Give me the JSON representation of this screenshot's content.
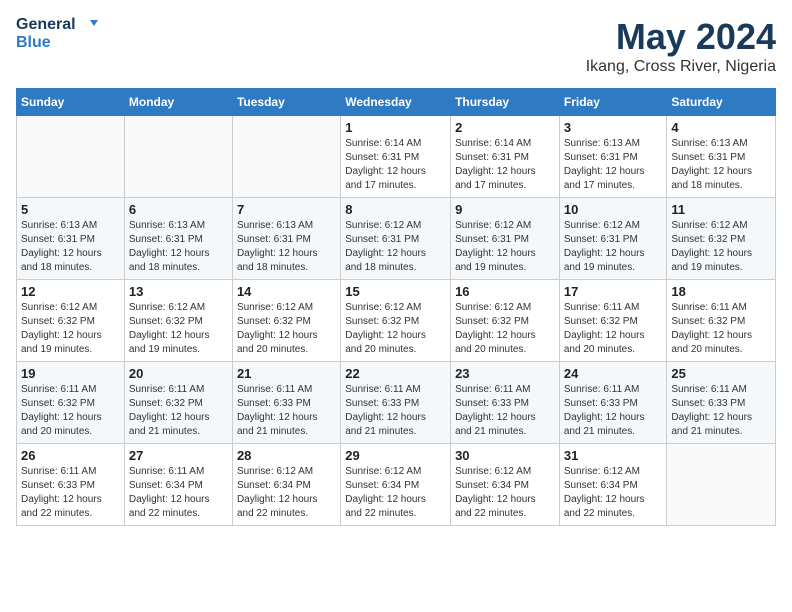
{
  "logo": {
    "line1": "General",
    "line2": "Blue"
  },
  "title": "May 2024",
  "subtitle": "Ikang, Cross River, Nigeria",
  "days_header": [
    "Sunday",
    "Monday",
    "Tuesday",
    "Wednesday",
    "Thursday",
    "Friday",
    "Saturday"
  ],
  "weeks": [
    [
      {
        "day": "",
        "info": ""
      },
      {
        "day": "",
        "info": ""
      },
      {
        "day": "",
        "info": ""
      },
      {
        "day": "1",
        "info": "Sunrise: 6:14 AM\nSunset: 6:31 PM\nDaylight: 12 hours\nand 17 minutes."
      },
      {
        "day": "2",
        "info": "Sunrise: 6:14 AM\nSunset: 6:31 PM\nDaylight: 12 hours\nand 17 minutes."
      },
      {
        "day": "3",
        "info": "Sunrise: 6:13 AM\nSunset: 6:31 PM\nDaylight: 12 hours\nand 17 minutes."
      },
      {
        "day": "4",
        "info": "Sunrise: 6:13 AM\nSunset: 6:31 PM\nDaylight: 12 hours\nand 18 minutes."
      }
    ],
    [
      {
        "day": "5",
        "info": "Sunrise: 6:13 AM\nSunset: 6:31 PM\nDaylight: 12 hours\nand 18 minutes."
      },
      {
        "day": "6",
        "info": "Sunrise: 6:13 AM\nSunset: 6:31 PM\nDaylight: 12 hours\nand 18 minutes."
      },
      {
        "day": "7",
        "info": "Sunrise: 6:13 AM\nSunset: 6:31 PM\nDaylight: 12 hours\nand 18 minutes."
      },
      {
        "day": "8",
        "info": "Sunrise: 6:12 AM\nSunset: 6:31 PM\nDaylight: 12 hours\nand 18 minutes."
      },
      {
        "day": "9",
        "info": "Sunrise: 6:12 AM\nSunset: 6:31 PM\nDaylight: 12 hours\nand 19 minutes."
      },
      {
        "day": "10",
        "info": "Sunrise: 6:12 AM\nSunset: 6:31 PM\nDaylight: 12 hours\nand 19 minutes."
      },
      {
        "day": "11",
        "info": "Sunrise: 6:12 AM\nSunset: 6:32 PM\nDaylight: 12 hours\nand 19 minutes."
      }
    ],
    [
      {
        "day": "12",
        "info": "Sunrise: 6:12 AM\nSunset: 6:32 PM\nDaylight: 12 hours\nand 19 minutes."
      },
      {
        "day": "13",
        "info": "Sunrise: 6:12 AM\nSunset: 6:32 PM\nDaylight: 12 hours\nand 19 minutes."
      },
      {
        "day": "14",
        "info": "Sunrise: 6:12 AM\nSunset: 6:32 PM\nDaylight: 12 hours\nand 20 minutes."
      },
      {
        "day": "15",
        "info": "Sunrise: 6:12 AM\nSunset: 6:32 PM\nDaylight: 12 hours\nand 20 minutes."
      },
      {
        "day": "16",
        "info": "Sunrise: 6:12 AM\nSunset: 6:32 PM\nDaylight: 12 hours\nand 20 minutes."
      },
      {
        "day": "17",
        "info": "Sunrise: 6:11 AM\nSunset: 6:32 PM\nDaylight: 12 hours\nand 20 minutes."
      },
      {
        "day": "18",
        "info": "Sunrise: 6:11 AM\nSunset: 6:32 PM\nDaylight: 12 hours\nand 20 minutes."
      }
    ],
    [
      {
        "day": "19",
        "info": "Sunrise: 6:11 AM\nSunset: 6:32 PM\nDaylight: 12 hours\nand 20 minutes."
      },
      {
        "day": "20",
        "info": "Sunrise: 6:11 AM\nSunset: 6:32 PM\nDaylight: 12 hours\nand 21 minutes."
      },
      {
        "day": "21",
        "info": "Sunrise: 6:11 AM\nSunset: 6:33 PM\nDaylight: 12 hours\nand 21 minutes."
      },
      {
        "day": "22",
        "info": "Sunrise: 6:11 AM\nSunset: 6:33 PM\nDaylight: 12 hours\nand 21 minutes."
      },
      {
        "day": "23",
        "info": "Sunrise: 6:11 AM\nSunset: 6:33 PM\nDaylight: 12 hours\nand 21 minutes."
      },
      {
        "day": "24",
        "info": "Sunrise: 6:11 AM\nSunset: 6:33 PM\nDaylight: 12 hours\nand 21 minutes."
      },
      {
        "day": "25",
        "info": "Sunrise: 6:11 AM\nSunset: 6:33 PM\nDaylight: 12 hours\nand 21 minutes."
      }
    ],
    [
      {
        "day": "26",
        "info": "Sunrise: 6:11 AM\nSunset: 6:33 PM\nDaylight: 12 hours\nand 22 minutes."
      },
      {
        "day": "27",
        "info": "Sunrise: 6:11 AM\nSunset: 6:34 PM\nDaylight: 12 hours\nand 22 minutes."
      },
      {
        "day": "28",
        "info": "Sunrise: 6:12 AM\nSunset: 6:34 PM\nDaylight: 12 hours\nand 22 minutes."
      },
      {
        "day": "29",
        "info": "Sunrise: 6:12 AM\nSunset: 6:34 PM\nDaylight: 12 hours\nand 22 minutes."
      },
      {
        "day": "30",
        "info": "Sunrise: 6:12 AM\nSunset: 6:34 PM\nDaylight: 12 hours\nand 22 minutes."
      },
      {
        "day": "31",
        "info": "Sunrise: 6:12 AM\nSunset: 6:34 PM\nDaylight: 12 hours\nand 22 minutes."
      },
      {
        "day": "",
        "info": ""
      }
    ]
  ]
}
